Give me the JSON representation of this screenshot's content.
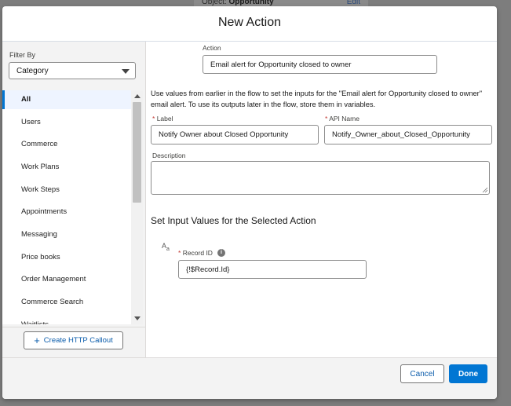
{
  "background": {
    "object_label": "Object:",
    "object_value": "Opportunity",
    "edit_link": "Edit"
  },
  "modal": {
    "title": "New Action"
  },
  "filter": {
    "label": "Filter By",
    "selected": "Category"
  },
  "categories": [
    {
      "label": "All",
      "active": true
    },
    {
      "label": "Users"
    },
    {
      "label": "Commerce"
    },
    {
      "label": "Work Plans"
    },
    {
      "label": "Work Steps"
    },
    {
      "label": "Appointments"
    },
    {
      "label": "Messaging"
    },
    {
      "label": "Price books"
    },
    {
      "label": "Order Management"
    },
    {
      "label": "Commerce Search"
    },
    {
      "label": "Waitlists"
    }
  ],
  "callout_button": "Create HTTP Callout",
  "form": {
    "action_label": "Action",
    "action_value": "Email alert for Opportunity closed to owner",
    "help_text": "Use values from earlier in the flow to set the inputs for the \"Email alert for Opportunity closed to owner\" email alert. To use its outputs later in the flow, store them in variables.",
    "required_marker": "*",
    "label_label": "Label",
    "label_value": "Notify Owner about Closed Opportunity",
    "api_name_label": "API Name",
    "api_name_value": "Notify_Owner_about_Closed_Opportunity",
    "description_label": "Description",
    "description_value": ""
  },
  "inputs_section": {
    "title": "Set Input Values for the Selected Action",
    "type_icon": "A",
    "type_icon_sub": "a",
    "record_id_label": "Record ID",
    "info_icon": "i",
    "record_id_value": "{!$Record.Id}"
  },
  "footer": {
    "cancel": "Cancel",
    "done": "Done"
  },
  "colors": {
    "brand": "#0176d3",
    "link": "#0b5cab",
    "required": "#c23934"
  }
}
